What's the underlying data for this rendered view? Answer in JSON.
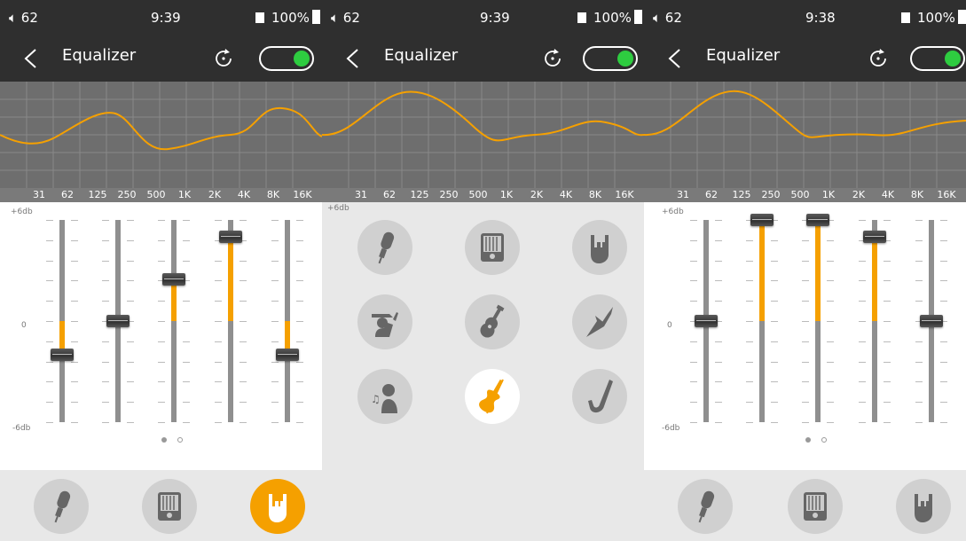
{
  "panels": [
    {
      "status": {
        "volume": "62",
        "time": "9:39",
        "battery": "100%"
      },
      "title": "Equalizer"
    },
    {
      "status": {
        "volume": "62",
        "time": "9:39",
        "battery": "100%"
      },
      "title": "Equalizer"
    },
    {
      "status": {
        "volume": "62",
        "time": "9:38",
        "battery": "100%"
      },
      "title": "Equalizer"
    }
  ],
  "eq_enabled": true,
  "frequencies": [
    "31",
    "62",
    "125",
    "250",
    "500",
    "1K",
    "2K",
    "4K",
    "8K",
    "16K"
  ],
  "db_labels": {
    "top": "+6db",
    "zero": "0",
    "bottom": "-6db"
  },
  "page_indicator": {
    "pages": 2,
    "current": 1
  },
  "panel1_band_levels_db": [
    -2,
    0,
    2.5,
    5,
    -2
  ],
  "panel3_band_levels_db": [
    0,
    6,
    6,
    5,
    0
  ],
  "presets": [
    {
      "icon": "microphone-icon",
      "name": "Vocal"
    },
    {
      "icon": "equalizer-device-icon",
      "name": "Custom"
    },
    {
      "icon": "rock-hand-icon",
      "name": "Rock"
    },
    {
      "icon": "jazz-singer-icon",
      "name": "Jazz"
    },
    {
      "icon": "acoustic-guitar-icon",
      "name": "Folk"
    },
    {
      "icon": "electric-guitar-icon",
      "name": "Metal"
    },
    {
      "icon": "singer-icon",
      "name": "Pop"
    },
    {
      "icon": "violin-icon",
      "name": "Classical"
    },
    {
      "icon": "saxophone-icon",
      "name": "Blues"
    }
  ],
  "active_preset_panel1": "rock-hand-icon",
  "active_preset_grid": "violin-icon",
  "colors": {
    "accent": "#f5a000",
    "toggle_on": "#2ecc40",
    "bar": "#2f2f2f",
    "graph_bg": "#6e6e6e"
  }
}
